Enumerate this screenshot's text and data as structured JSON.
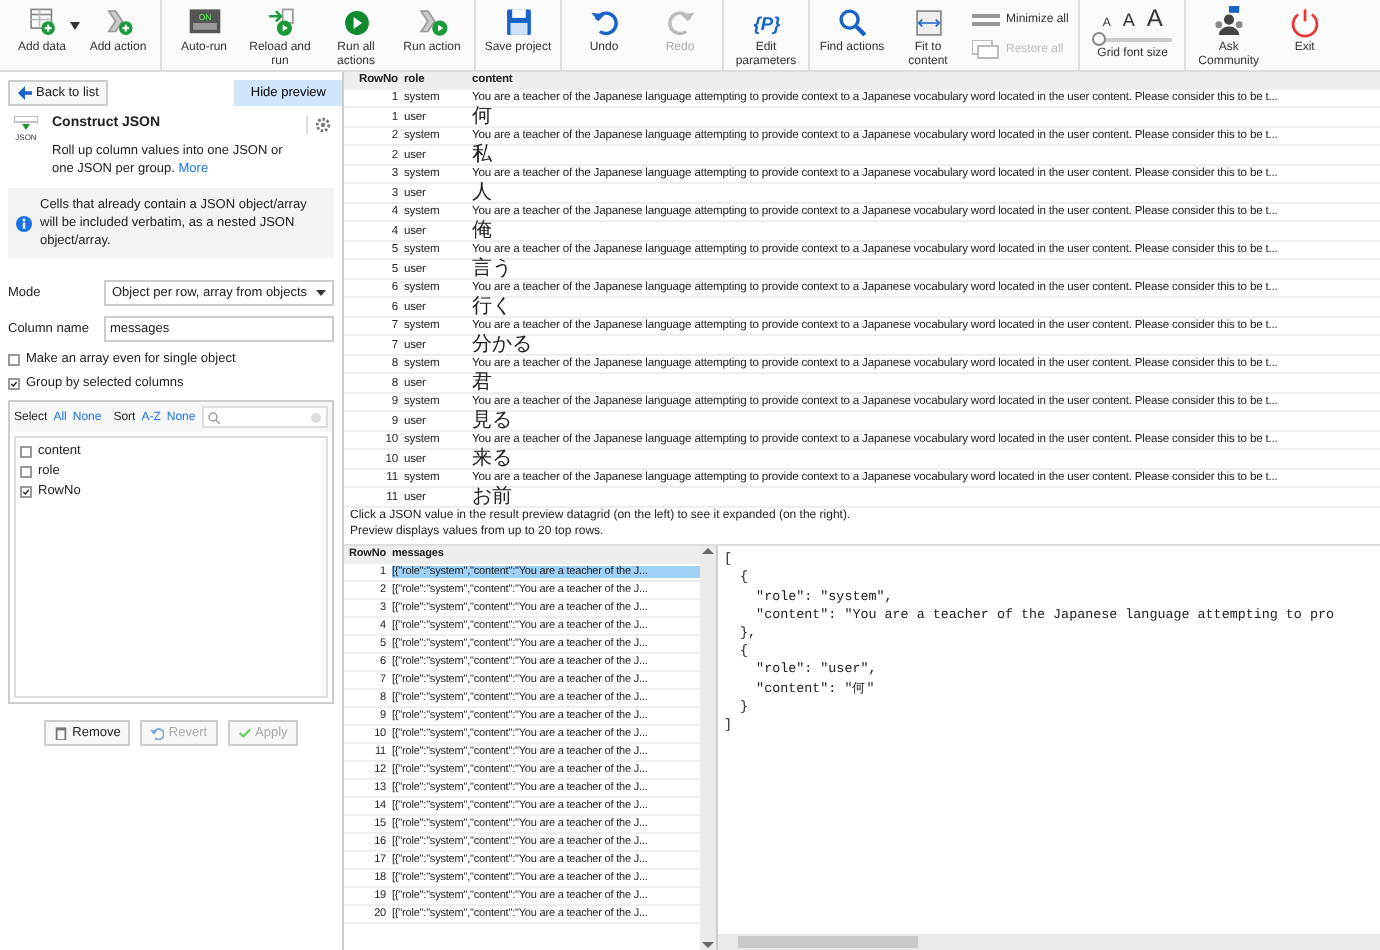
{
  "toolbar": {
    "groups": [
      {
        "items": [
          {
            "kind": "button",
            "label": "Add data",
            "menu": true,
            "disabled": false
          },
          {
            "kind": "button",
            "label": "Add action",
            "menu": false,
            "disabled": false
          }
        ]
      },
      {
        "items": [
          {
            "kind": "button",
            "label": "Auto-run",
            "icon_text": "ON",
            "menu": false,
            "disabled": false
          },
          {
            "kind": "button",
            "label": "Reload and run",
            "menu": false,
            "disabled": false
          },
          {
            "kind": "button",
            "label": "Run all actions",
            "menu": false,
            "disabled": false
          },
          {
            "kind": "button",
            "label": "Run action",
            "menu": false,
            "disabled": false
          }
        ]
      },
      {
        "items": [
          {
            "kind": "button",
            "label": "Save project",
            "menu": false,
            "disabled": false
          }
        ]
      },
      {
        "items": [
          {
            "kind": "button",
            "label": "Undo",
            "menu": false,
            "disabled": false
          },
          {
            "kind": "button",
            "label": "Redo",
            "menu": false,
            "disabled": true
          }
        ]
      },
      {
        "items": [
          {
            "kind": "button",
            "label": "Edit parameters",
            "icon_text": "{P}",
            "menu": false,
            "disabled": false
          }
        ]
      },
      {
        "items": [
          {
            "kind": "button",
            "label": "Find actions",
            "menu": false,
            "disabled": false
          },
          {
            "kind": "button",
            "label": "Fit to content",
            "menu": false,
            "disabled": false
          },
          {
            "kind": "stack",
            "buttons": [
              {
                "label": "Minimize all",
                "disabled": false
              },
              {
                "label": "Restore all",
                "disabled": true
              }
            ]
          }
        ]
      },
      {
        "items": [
          {
            "kind": "font_size",
            "label": "Grid font size",
            "letters": [
              "A",
              "A",
              "A"
            ],
            "level": 0.05
          }
        ]
      },
      {
        "items": [
          {
            "kind": "button",
            "label": "Ask Community",
            "menu": false,
            "disabled": false
          },
          {
            "kind": "button",
            "label": "Exit",
            "menu": false,
            "disabled": false
          }
        ]
      }
    ]
  },
  "sidebar": {
    "back_button": "Back to list",
    "preview_button": "Hide preview",
    "step": {
      "icon_text": "JSON",
      "title": "Construct JSON",
      "description": "Roll up column values into one JSON or one JSON per group.",
      "link": "More"
    },
    "info": "Cells that already contain a JSON object/array will be included verbatim, as a nested JSON object/array.",
    "mode": {
      "label": "Mode",
      "value": "Object per row, array from objects"
    },
    "column_name": {
      "label": "Column name",
      "value": "messages"
    },
    "options": [
      {
        "label": "Make an array even for single object",
        "checked": false
      },
      {
        "label": "Group by selected columns",
        "checked": true
      }
    ],
    "column_picker": {
      "select_label": "Select",
      "select_links": [
        "All",
        "None"
      ],
      "sort_label": "Sort",
      "sort_links": [
        "A-Z",
        "None"
      ],
      "columns": [
        {
          "name": "content",
          "checked": false
        },
        {
          "name": "role",
          "checked": false
        },
        {
          "name": "RowNo",
          "checked": true
        }
      ]
    },
    "buttons": [
      {
        "label": "Remove",
        "disabled": false
      },
      {
        "label": "Revert",
        "disabled": true
      },
      {
        "label": "Apply",
        "disabled": true
      }
    ]
  },
  "table": {
    "columns": [
      "RowNo",
      "role",
      "content"
    ],
    "rows": [
      {
        "row_no": "1",
        "role": "system",
        "content": "You are a teacher of the Japanese language attempting to provide context to a Japanese vocabulary word located in the user content. Please consider this to be t..."
      },
      {
        "row_no": "1",
        "role": "user",
        "content": "何"
      },
      {
        "row_no": "2",
        "role": "system",
        "content": "You are a teacher of the Japanese language attempting to provide context to a Japanese vocabulary word located in the user content. Please consider this to be t..."
      },
      {
        "row_no": "2",
        "role": "user",
        "content": "私"
      },
      {
        "row_no": "3",
        "role": "system",
        "content": "You are a teacher of the Japanese language attempting to provide context to a Japanese vocabulary word located in the user content. Please consider this to be t..."
      },
      {
        "row_no": "3",
        "role": "user",
        "content": "人"
      },
      {
        "row_no": "4",
        "role": "system",
        "content": "You are a teacher of the Japanese language attempting to provide context to a Japanese vocabulary word located in the user content. Please consider this to be t..."
      },
      {
        "row_no": "4",
        "role": "user",
        "content": "俺"
      },
      {
        "row_no": "5",
        "role": "system",
        "content": "You are a teacher of the Japanese language attempting to provide context to a Japanese vocabulary word located in the user content. Please consider this to be t..."
      },
      {
        "row_no": "5",
        "role": "user",
        "content": "言う"
      },
      {
        "row_no": "6",
        "role": "system",
        "content": "You are a teacher of the Japanese language attempting to provide context to a Japanese vocabulary word located in the user content. Please consider this to be t..."
      },
      {
        "row_no": "6",
        "role": "user",
        "content": "行く"
      },
      {
        "row_no": "7",
        "role": "system",
        "content": "You are a teacher of the Japanese language attempting to provide context to a Japanese vocabulary word located in the user content. Please consider this to be t..."
      },
      {
        "row_no": "7",
        "role": "user",
        "content": "分かる"
      },
      {
        "row_no": "8",
        "role": "system",
        "content": "You are a teacher of the Japanese language attempting to provide context to a Japanese vocabulary word located in the user content. Please consider this to be t..."
      },
      {
        "row_no": "8",
        "role": "user",
        "content": "君"
      },
      {
        "row_no": "9",
        "role": "system",
        "content": "You are a teacher of the Japanese language attempting to provide context to a Japanese vocabulary word located in the user content. Please consider this to be t..."
      },
      {
        "row_no": "9",
        "role": "user",
        "content": "見る"
      },
      {
        "row_no": "10",
        "role": "system",
        "content": "You are a teacher of the Japanese language attempting to provide context to a Japanese vocabulary word located in the user content. Please consider this to be t..."
      },
      {
        "row_no": "10",
        "role": "user",
        "content": "来る"
      },
      {
        "row_no": "11",
        "role": "system",
        "content": "You are a teacher of the Japanese language attempting to provide context to a Japanese vocabulary word located in the user content. Please consider this to be t..."
      },
      {
        "row_no": "11",
        "role": "user",
        "content": "お前"
      }
    ]
  },
  "preview": {
    "hint": [
      "Click a JSON value in the result preview datagrid (on the left) to see it expanded (on the right).",
      "Preview displays values from up to 20 top rows."
    ],
    "grid": {
      "columns": [
        "RowNo",
        "messages"
      ],
      "rows": [
        {
          "row_no": "1",
          "value": "[{\"role\":\"system\",\"content\":\"You are a teacher of the J...",
          "selected": true
        },
        {
          "row_no": "2",
          "value": "[{\"role\":\"system\",\"content\":\"You are a teacher of the J...",
          "selected": false
        },
        {
          "row_no": "3",
          "value": "[{\"role\":\"system\",\"content\":\"You are a teacher of the J...",
          "selected": false
        },
        {
          "row_no": "4",
          "value": "[{\"role\":\"system\",\"content\":\"You are a teacher of the J...",
          "selected": false
        },
        {
          "row_no": "5",
          "value": "[{\"role\":\"system\",\"content\":\"You are a teacher of the J...",
          "selected": false
        },
        {
          "row_no": "6",
          "value": "[{\"role\":\"system\",\"content\":\"You are a teacher of the J...",
          "selected": false
        },
        {
          "row_no": "7",
          "value": "[{\"role\":\"system\",\"content\":\"You are a teacher of the J...",
          "selected": false
        },
        {
          "row_no": "8",
          "value": "[{\"role\":\"system\",\"content\":\"You are a teacher of the J...",
          "selected": false
        },
        {
          "row_no": "9",
          "value": "[{\"role\":\"system\",\"content\":\"You are a teacher of the J...",
          "selected": false
        },
        {
          "row_no": "10",
          "value": "[{\"role\":\"system\",\"content\":\"You are a teacher of the J...",
          "selected": false
        },
        {
          "row_no": "11",
          "value": "[{\"role\":\"system\",\"content\":\"You are a teacher of the J...",
          "selected": false
        },
        {
          "row_no": "12",
          "value": "[{\"role\":\"system\",\"content\":\"You are a teacher of the J...",
          "selected": false
        },
        {
          "row_no": "13",
          "value": "[{\"role\":\"system\",\"content\":\"You are a teacher of the J...",
          "selected": false
        },
        {
          "row_no": "14",
          "value": "[{\"role\":\"system\",\"content\":\"You are a teacher of the J...",
          "selected": false
        },
        {
          "row_no": "15",
          "value": "[{\"role\":\"system\",\"content\":\"You are a teacher of the J...",
          "selected": false
        },
        {
          "row_no": "16",
          "value": "[{\"role\":\"system\",\"content\":\"You are a teacher of the J...",
          "selected": false
        },
        {
          "row_no": "17",
          "value": "[{\"role\":\"system\",\"content\":\"You are a teacher of the J...",
          "selected": false
        },
        {
          "row_no": "18",
          "value": "[{\"role\":\"system\",\"content\":\"You are a teacher of the J...",
          "selected": false
        },
        {
          "row_no": "19",
          "value": "[{\"role\":\"system\",\"content\":\"You are a teacher of the J...",
          "selected": false
        },
        {
          "row_no": "20",
          "value": "[{\"role\":\"system\",\"content\":\"You are a teacher of the J...",
          "selected": false
        }
      ]
    },
    "json_lines": [
      "[",
      "  {",
      "    \"role\": \"system\",",
      "    \"content\": \"You are a teacher of the Japanese language attempting to pro",
      "  },",
      "  {",
      "    \"role\": \"user\",",
      "    \"content\": \"何\"",
      "  }",
      "]"
    ]
  }
}
